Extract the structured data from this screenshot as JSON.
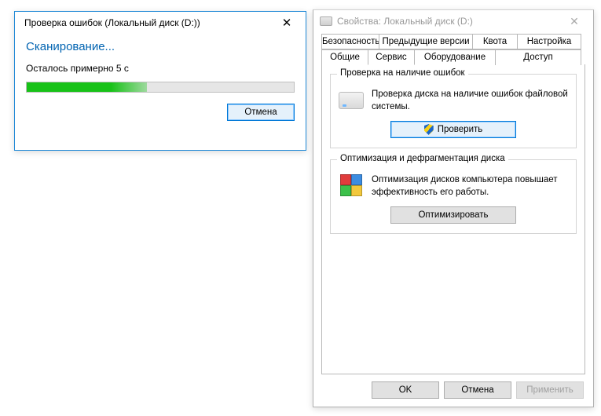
{
  "scan_dialog": {
    "title": "Проверка ошибок (Локальный диск (D:))",
    "status": "Сканирование...",
    "remaining": "Осталось примерно 5 с",
    "progress_percent": 45,
    "cancel": "Отмена"
  },
  "props_dialog": {
    "title": "Свойства: Локальный диск (D:)",
    "tabs_row1": [
      "Безопасность",
      "Предыдущие версии",
      "Квота",
      "Настройка"
    ],
    "tabs_row2": [
      "Общие",
      "Сервис",
      "Оборудование",
      "Доступ"
    ],
    "active_tab": "Сервис",
    "error_check": {
      "group": "Проверка на наличие ошибок",
      "desc": "Проверка диска на наличие ошибок файловой системы.",
      "button": "Проверить"
    },
    "optimize": {
      "group": "Оптимизация и дефрагментация диска",
      "desc": "Оптимизация дисков компьютера повышает эффективность его работы.",
      "button": "Оптимизировать"
    },
    "footer": {
      "ok": "OK",
      "cancel": "Отмена",
      "apply": "Применить"
    }
  }
}
